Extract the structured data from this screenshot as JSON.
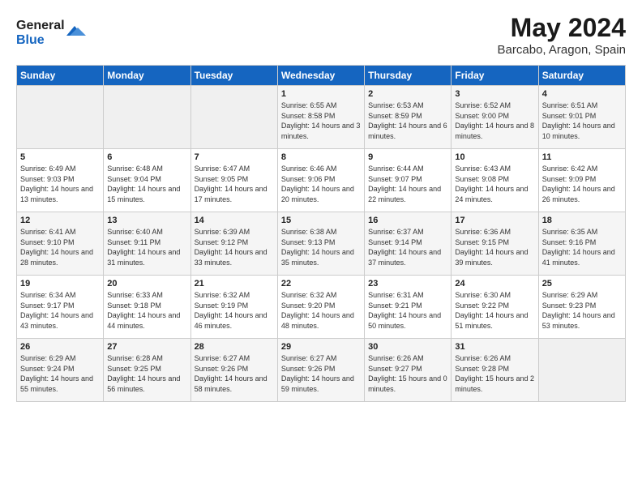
{
  "header": {
    "logo_line1": "General",
    "logo_line2": "Blue",
    "month_title": "May 2024",
    "location": "Barcabo, Aragon, Spain"
  },
  "weekdays": [
    "Sunday",
    "Monday",
    "Tuesday",
    "Wednesday",
    "Thursday",
    "Friday",
    "Saturday"
  ],
  "weeks": [
    [
      {
        "day": "",
        "empty": true
      },
      {
        "day": "",
        "empty": true
      },
      {
        "day": "",
        "empty": true
      },
      {
        "day": "1",
        "sunrise": "6:55 AM",
        "sunset": "8:58 PM",
        "daylight": "14 hours and 3 minutes."
      },
      {
        "day": "2",
        "sunrise": "6:53 AM",
        "sunset": "8:59 PM",
        "daylight": "14 hours and 6 minutes."
      },
      {
        "day": "3",
        "sunrise": "6:52 AM",
        "sunset": "9:00 PM",
        "daylight": "14 hours and 8 minutes."
      },
      {
        "day": "4",
        "sunrise": "6:51 AM",
        "sunset": "9:01 PM",
        "daylight": "14 hours and 10 minutes."
      }
    ],
    [
      {
        "day": "5",
        "sunrise": "6:49 AM",
        "sunset": "9:03 PM",
        "daylight": "14 hours and 13 minutes."
      },
      {
        "day": "6",
        "sunrise": "6:48 AM",
        "sunset": "9:04 PM",
        "daylight": "14 hours and 15 minutes."
      },
      {
        "day": "7",
        "sunrise": "6:47 AM",
        "sunset": "9:05 PM",
        "daylight": "14 hours and 17 minutes."
      },
      {
        "day": "8",
        "sunrise": "6:46 AM",
        "sunset": "9:06 PM",
        "daylight": "14 hours and 20 minutes."
      },
      {
        "day": "9",
        "sunrise": "6:44 AM",
        "sunset": "9:07 PM",
        "daylight": "14 hours and 22 minutes."
      },
      {
        "day": "10",
        "sunrise": "6:43 AM",
        "sunset": "9:08 PM",
        "daylight": "14 hours and 24 minutes."
      },
      {
        "day": "11",
        "sunrise": "6:42 AM",
        "sunset": "9:09 PM",
        "daylight": "14 hours and 26 minutes."
      }
    ],
    [
      {
        "day": "12",
        "sunrise": "6:41 AM",
        "sunset": "9:10 PM",
        "daylight": "14 hours and 28 minutes."
      },
      {
        "day": "13",
        "sunrise": "6:40 AM",
        "sunset": "9:11 PM",
        "daylight": "14 hours and 31 minutes."
      },
      {
        "day": "14",
        "sunrise": "6:39 AM",
        "sunset": "9:12 PM",
        "daylight": "14 hours and 33 minutes."
      },
      {
        "day": "15",
        "sunrise": "6:38 AM",
        "sunset": "9:13 PM",
        "daylight": "14 hours and 35 minutes."
      },
      {
        "day": "16",
        "sunrise": "6:37 AM",
        "sunset": "9:14 PM",
        "daylight": "14 hours and 37 minutes."
      },
      {
        "day": "17",
        "sunrise": "6:36 AM",
        "sunset": "9:15 PM",
        "daylight": "14 hours and 39 minutes."
      },
      {
        "day": "18",
        "sunrise": "6:35 AM",
        "sunset": "9:16 PM",
        "daylight": "14 hours and 41 minutes."
      }
    ],
    [
      {
        "day": "19",
        "sunrise": "6:34 AM",
        "sunset": "9:17 PM",
        "daylight": "14 hours and 43 minutes."
      },
      {
        "day": "20",
        "sunrise": "6:33 AM",
        "sunset": "9:18 PM",
        "daylight": "14 hours and 44 minutes."
      },
      {
        "day": "21",
        "sunrise": "6:32 AM",
        "sunset": "9:19 PM",
        "daylight": "14 hours and 46 minutes."
      },
      {
        "day": "22",
        "sunrise": "6:32 AM",
        "sunset": "9:20 PM",
        "daylight": "14 hours and 48 minutes."
      },
      {
        "day": "23",
        "sunrise": "6:31 AM",
        "sunset": "9:21 PM",
        "daylight": "14 hours and 50 minutes."
      },
      {
        "day": "24",
        "sunrise": "6:30 AM",
        "sunset": "9:22 PM",
        "daylight": "14 hours and 51 minutes."
      },
      {
        "day": "25",
        "sunrise": "6:29 AM",
        "sunset": "9:23 PM",
        "daylight": "14 hours and 53 minutes."
      }
    ],
    [
      {
        "day": "26",
        "sunrise": "6:29 AM",
        "sunset": "9:24 PM",
        "daylight": "14 hours and 55 minutes."
      },
      {
        "day": "27",
        "sunrise": "6:28 AM",
        "sunset": "9:25 PM",
        "daylight": "14 hours and 56 minutes."
      },
      {
        "day": "28",
        "sunrise": "6:27 AM",
        "sunset": "9:26 PM",
        "daylight": "14 hours and 58 minutes."
      },
      {
        "day": "29",
        "sunrise": "6:27 AM",
        "sunset": "9:26 PM",
        "daylight": "14 hours and 59 minutes."
      },
      {
        "day": "30",
        "sunrise": "6:26 AM",
        "sunset": "9:27 PM",
        "daylight": "15 hours and 0 minutes."
      },
      {
        "day": "31",
        "sunrise": "6:26 AM",
        "sunset": "9:28 PM",
        "daylight": "15 hours and 2 minutes."
      },
      {
        "day": "",
        "empty": true
      }
    ]
  ],
  "labels": {
    "sunrise_prefix": "Sunrise: ",
    "sunset_prefix": "Sunset: ",
    "daylight_prefix": "Daylight: "
  }
}
